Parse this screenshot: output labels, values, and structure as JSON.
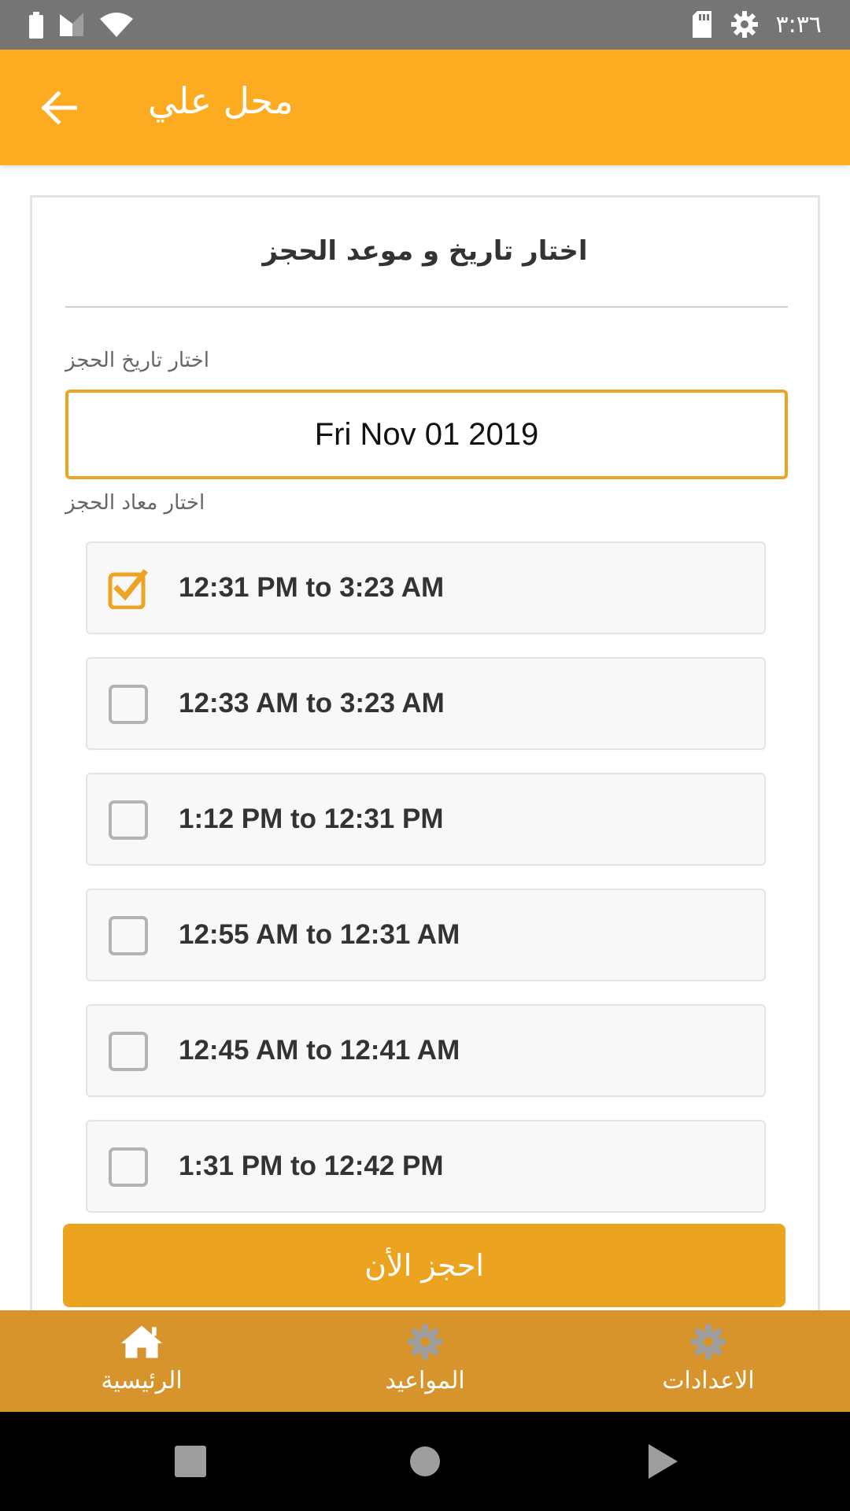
{
  "status_bar": {
    "time": "٣:٣٦",
    "icons": [
      "battery-icon",
      "signal-icon",
      "wifi-icon",
      "sd-card-icon",
      "settings-icon"
    ]
  },
  "app_bar": {
    "title": "محل علي",
    "back_icon": "arrow-left-icon"
  },
  "booking": {
    "heading": "اختار تاريخ و موعد الحجز",
    "date_label": "اختار تاريخ الحجز",
    "date_value": "Fri Nov 01 2019",
    "time_label": "اختار معاد الحجز",
    "slots": [
      {
        "label": "12:31 PM to 3:23 AM",
        "checked": true
      },
      {
        "label": "12:33 AM to 3:23 AM",
        "checked": false
      },
      {
        "label": "1:12 PM to 12:31 PM",
        "checked": false
      },
      {
        "label": "12:55 AM to 12:31 AM",
        "checked": false
      },
      {
        "label": "12:45 AM to 12:41 AM",
        "checked": false
      },
      {
        "label": "1:31 PM to 12:42 PM",
        "checked": false
      }
    ],
    "book_button": "احجز الأن"
  },
  "bottom_nav": {
    "items": [
      {
        "label": "الرئيسية",
        "icon": "home-icon"
      },
      {
        "label": "المواعيد",
        "icon": "gear-icon"
      },
      {
        "label": "الاعدادات",
        "icon": "gear-icon"
      }
    ]
  },
  "colors": {
    "app_bar": "#fdac22",
    "accent": "#eda323",
    "bottom_nav": "#d7932c",
    "status_bar": "#757575"
  }
}
